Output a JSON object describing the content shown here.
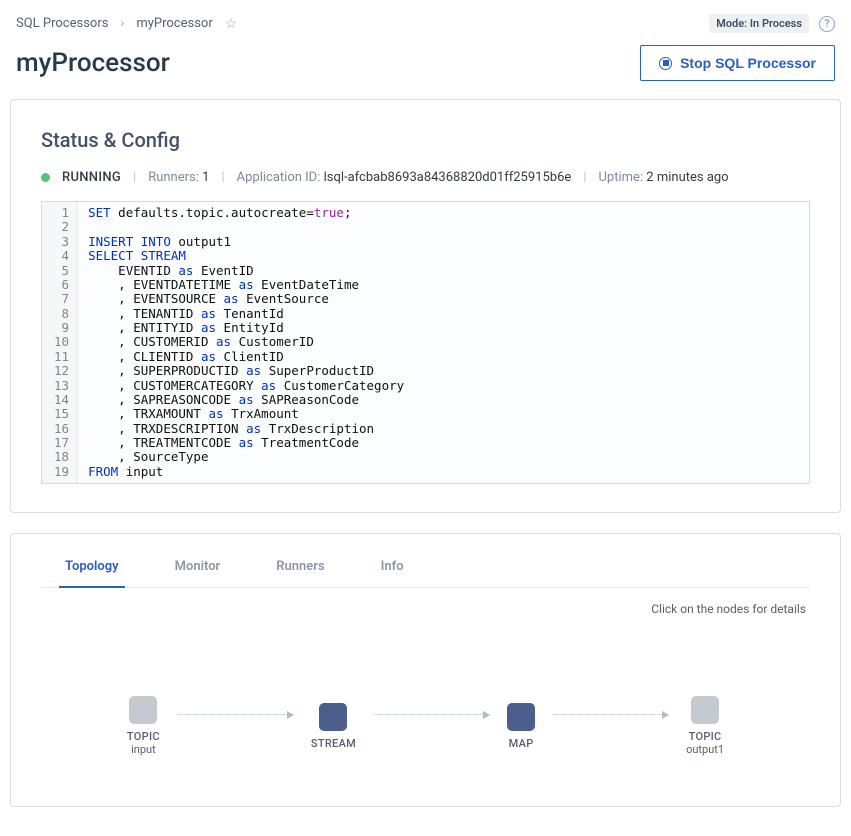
{
  "breadcrumb": {
    "root": "SQL Processors",
    "current": "myProcessor"
  },
  "mode_badge": "Mode: In Process",
  "page_title": "myProcessor",
  "stop_button_label": "Stop SQL Processor",
  "status_config": {
    "heading": "Status & Config",
    "state": "RUNNING",
    "runners_label": "Runners:",
    "runners_value": "1",
    "appid_label": "Application ID:",
    "appid_value": "lsql-afcbab8693a84368820d01ff25915b6e",
    "uptime_label": "Uptime:",
    "uptime_value": "2 minutes ago"
  },
  "code": {
    "lines": [
      {
        "n": "1",
        "t": "<span class='kw'>SET</span> <span class='dot-chain'>defaults.topic.autocreate</span>=<span class='bool'>true</span>;"
      },
      {
        "n": "2",
        "t": ""
      },
      {
        "n": "3",
        "t": "<span class='kw'>INSERT INTO</span> output1"
      },
      {
        "n": "4",
        "t": "<span class='kw'>SELECT</span> <span class='kw'>STREAM</span>"
      },
      {
        "n": "5",
        "t": "    EVENTID <span class='kw'>as</span> EventID"
      },
      {
        "n": "6",
        "t": "    , EVENTDATETIME <span class='kw'>as</span> EventDateTime"
      },
      {
        "n": "7",
        "t": "    , EVENTSOURCE <span class='kw'>as</span> EventSource"
      },
      {
        "n": "8",
        "t": "    , TENANTID <span class='kw'>as</span> TenantId"
      },
      {
        "n": "9",
        "t": "    , ENTITYID <span class='kw'>as</span> EntityId"
      },
      {
        "n": "10",
        "t": "    , CUSTOMERID <span class='kw'>as</span> CustomerID"
      },
      {
        "n": "11",
        "t": "    , CLIENTID <span class='kw'>as</span> ClientID"
      },
      {
        "n": "12",
        "t": "    , SUPERPRODUCTID <span class='kw'>as</span> SuperProductID"
      },
      {
        "n": "13",
        "t": "    , CUSTOMERCATEGORY <span class='kw'>as</span> CustomerCategory"
      },
      {
        "n": "14",
        "t": "    , SAPREASONCODE <span class='kw'>as</span> SAPReasonCode"
      },
      {
        "n": "15",
        "t": "    , TRXAMOUNT <span class='kw'>as</span> TrxAmount"
      },
      {
        "n": "16",
        "t": "    , TRXDESCRIPTION <span class='kw'>as</span> TrxDescription"
      },
      {
        "n": "17",
        "t": "    , TREATMENTCODE <span class='kw'>as</span> TreatmentCode"
      },
      {
        "n": "18",
        "t": "    , SourceType"
      },
      {
        "n": "19",
        "t": "<span class='kw'>FROM</span> input"
      }
    ]
  },
  "tabs": [
    "Topology",
    "Monitor",
    "Runners",
    "Info"
  ],
  "active_tab": "Topology",
  "topology_hint": "Click on the nodes for details",
  "topology_nodes": [
    {
      "kind": "gray",
      "title": "TOPIC",
      "sub": "input"
    },
    {
      "kind": "blue",
      "title": "STREAM",
      "sub": ""
    },
    {
      "kind": "blue",
      "title": "MAP",
      "sub": ""
    },
    {
      "kind": "gray",
      "title": "TOPIC",
      "sub": "output1"
    }
  ]
}
